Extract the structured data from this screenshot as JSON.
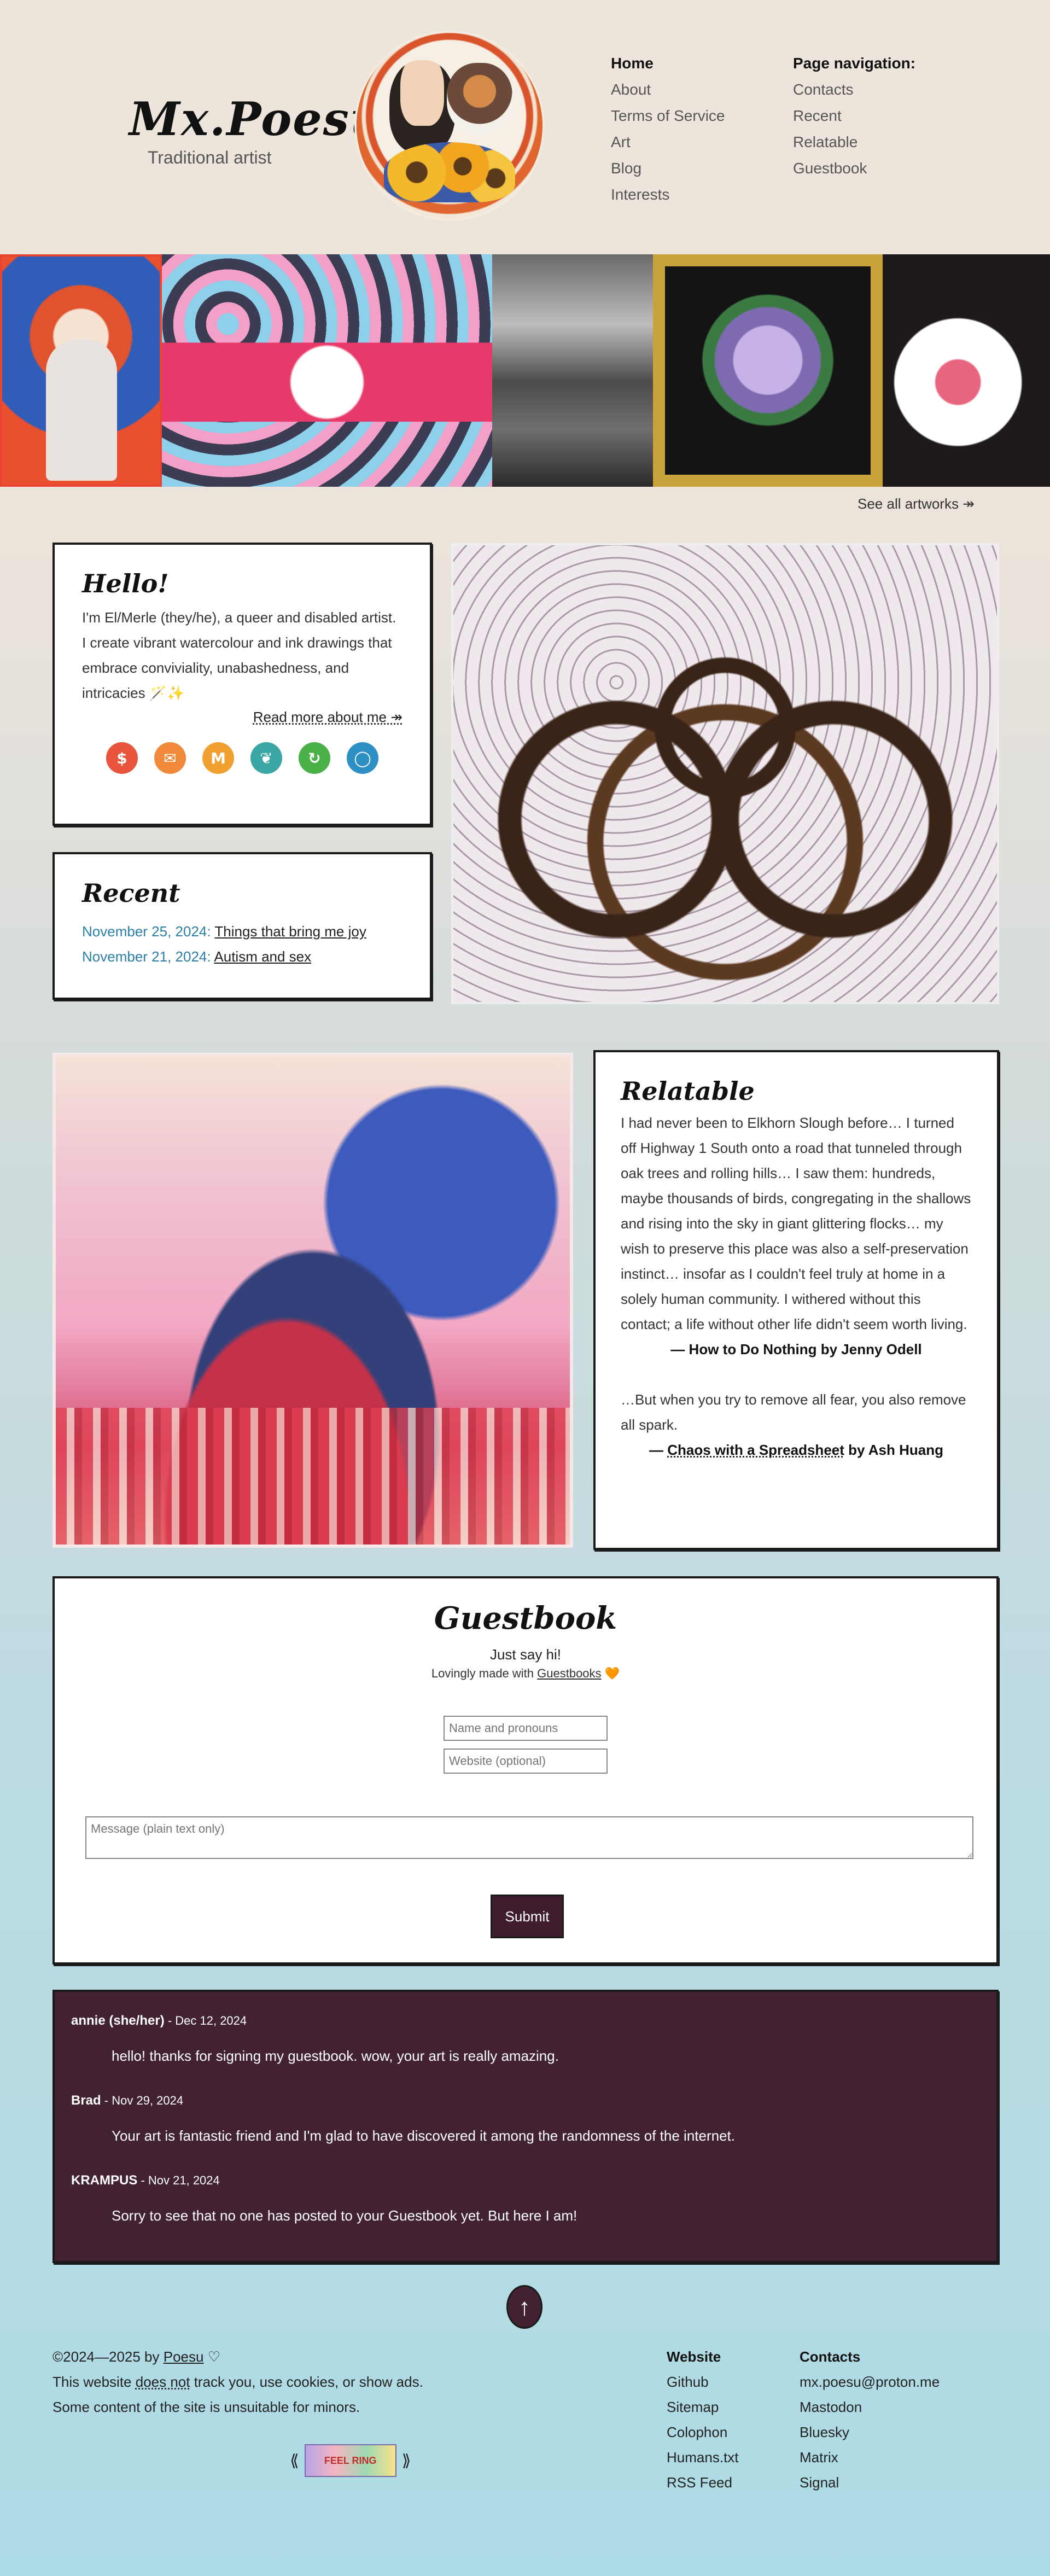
{
  "header": {
    "title": "Mx.Poesu",
    "subtitle": "Traditional artist",
    "nav_main": [
      "Home",
      "About",
      "Terms of Service",
      "Art",
      "Blog",
      "Interests"
    ],
    "nav_page_heading": "Page navigation:",
    "nav_page": [
      "Contacts",
      "Recent",
      "Relatable",
      "Guestbook"
    ]
  },
  "gallery": {
    "see_all": "See all artworks ↠"
  },
  "hello": {
    "title": "Hello!",
    "text": "I'm El/Merle (they/he), a queer and disabled artist. I create vibrant watercolour and ink drawings that embrace conviviality, unabashedness, and intricacies 🪄✨",
    "read_more": "Read more about me ↠",
    "socials": [
      {
        "icon": "ko-fi-icon",
        "glyph": "$",
        "color": "#e8553c"
      },
      {
        "icon": "email-icon",
        "glyph": "✉",
        "color": "#f08a3a"
      },
      {
        "icon": "mastodon-icon",
        "glyph": "M",
        "color": "#f0a030"
      },
      {
        "icon": "bluesky-icon",
        "glyph": "❦",
        "color": "#3aa7a4"
      },
      {
        "icon": "matrix-icon",
        "glyph": "↻",
        "color": "#4ab048"
      },
      {
        "icon": "signal-icon",
        "glyph": "◯",
        "color": "#2e8fc4"
      }
    ]
  },
  "recent": {
    "title": "Recent",
    "posts": [
      {
        "date": "November 25, 2024:",
        "title": "Things that bring me joy"
      },
      {
        "date": "November 21, 2024:",
        "title": "Autism and sex"
      }
    ]
  },
  "relatable": {
    "title": "Relatable",
    "quote1": "I had never been to Elkhorn Slough before… I turned off Highway 1 South onto a road that tunneled through oak trees and rolling hills… I saw them: hundreds, maybe thousands of birds, congregating in the shallows and rising into the sky in giant glittering flocks… my wish to preserve this place was also a self-preservation instinct… insofar as I couldn't feel truly at home in a solely human community. I withered without this contact; a life without other life didn't seem worth living.",
    "cite1": "— How to Do Nothing by Jenny Odell",
    "quote2": "…But when you try to remove all fear, you also remove all spark.",
    "cite2_prefix": "— ",
    "cite2_book": "Chaos with a Spreadsheet",
    "cite2_suffix": " by Ash Huang"
  },
  "guestbook": {
    "title": "Guestbook",
    "subtitle": "Just say hi!",
    "made_prefix": "Lovingly made with ",
    "made_link": "Guestbooks",
    "made_suffix": " 🧡",
    "name_placeholder": "Name and pronouns",
    "website_placeholder": "Website (optional)",
    "message_placeholder": "Message (plain text only)",
    "submit_label": "Submit",
    "entries": [
      {
        "name": "annie (she/her)",
        "date": " - Dec 12, 2024",
        "message": "hello! thanks for signing my guestbook. wow, your art is really amazing."
      },
      {
        "name": "Brad",
        "date": " - Nov 29, 2024",
        "message": "Your art is fantastic friend and I'm glad to have discovered it among the randomness of the internet."
      },
      {
        "name": "KRAMPUS",
        "date": " - Nov 21, 2024",
        "message": "Sorry to see that no one has posted to your Guestbook yet. But here I am!"
      }
    ]
  },
  "footer": {
    "copyright_prefix": "©2024—2025 by ",
    "copyright_name": "Poesu",
    "copyright_suffix": " ♡",
    "tracking_prefix": "This website ",
    "tracking_emph": "does not",
    "tracking_suffix": " track you, use cookies, or show ads.",
    "minors": "Some content of the site is unsuitable for minors.",
    "webring_prev": "⟪",
    "webring_next": "⟫",
    "webring_badge": "FEEL RING",
    "website_heading": "Website",
    "website_links": [
      "Github",
      "Sitemap",
      "Colophon",
      "Humans.txt",
      "RSS Feed"
    ],
    "contacts_heading": "Contacts",
    "contacts_links": [
      "mx.poesu@proton.me",
      "Mastodon",
      "Bluesky",
      "Matrix",
      "Signal"
    ]
  }
}
